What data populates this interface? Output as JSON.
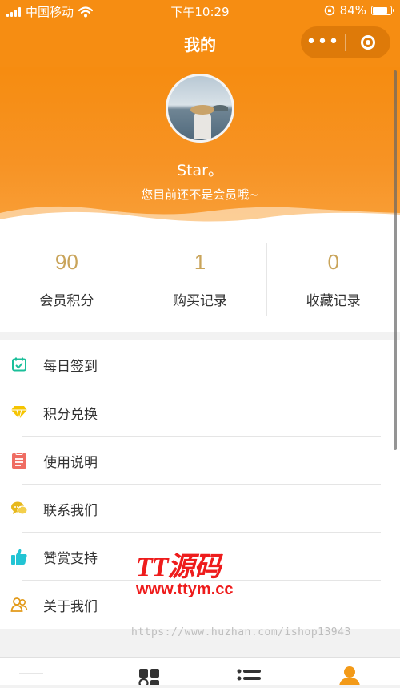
{
  "status": {
    "carrier": "中国移动",
    "time": "下午10:29",
    "battery_text": "84%",
    "battery_level": 0.84,
    "signal_icon": "signal-bars-icon",
    "wifi_icon": "wifi-icon",
    "rotation_lock_icon": "rotation-lock-icon"
  },
  "navbar": {
    "title": "我的",
    "more_glyph": "•••"
  },
  "profile": {
    "name": "Star。",
    "membership_text": "您目前还不是会员哦~"
  },
  "stats": [
    {
      "value": "90",
      "label": "会员积分"
    },
    {
      "value": "1",
      "label": "购买记录"
    },
    {
      "value": "0",
      "label": "收藏记录"
    }
  ],
  "menu": [
    {
      "label": "每日签到",
      "icon": "calendar-check-icon",
      "color": "#1bbf9a"
    },
    {
      "label": "积分兑换",
      "icon": "diamond-icon",
      "color": "#f5c400"
    },
    {
      "label": "使用说明",
      "icon": "document-list-icon",
      "color": "#ef6c62"
    },
    {
      "label": "联系我们",
      "icon": "chat-bubbles-icon",
      "color": "#e7b81c"
    },
    {
      "label": "赞赏支持",
      "icon": "thumbs-up-icon",
      "color": "#22c4d4"
    },
    {
      "label": "关于我们",
      "icon": "users-icon",
      "color": "#e29a1a"
    }
  ],
  "watermark": {
    "logo_line1": "TT源码",
    "logo_line2": "www.ttym.cc",
    "url": "https://www.huzhan.com/ishop13943"
  },
  "colors": {
    "primary": "#f68d12",
    "stat_number": "#c9a45a",
    "active_tab": "#f39a18"
  },
  "tabbar": {
    "tabs": [
      {
        "icon": "home-icon"
      },
      {
        "icon": "category-grid-icon"
      },
      {
        "icon": "list-icon"
      },
      {
        "icon": "user-profile-icon",
        "active": true
      }
    ]
  }
}
